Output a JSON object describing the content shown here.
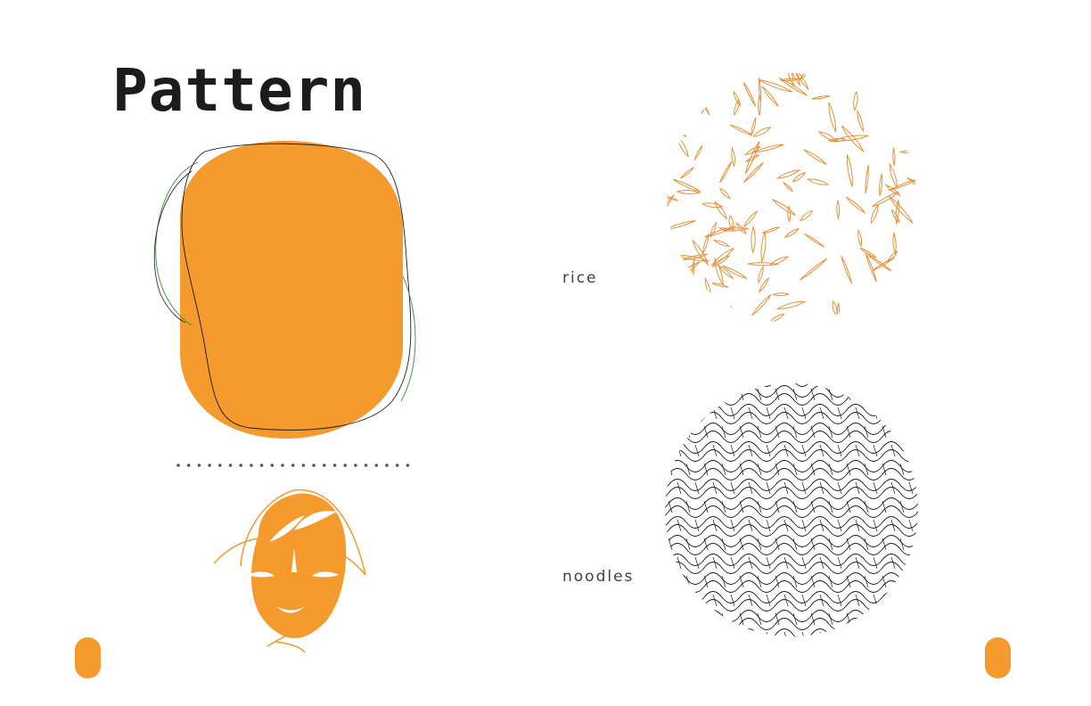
{
  "page": {
    "title": "Pattern",
    "accent_color": "#f59a2c",
    "ink_color": "#1c1c1c"
  },
  "patterns": [
    {
      "label": "rice",
      "motif": "rice-grain-scatter",
      "color": "#e8913a"
    },
    {
      "label": "noodles",
      "motif": "wavy-noodle-lines",
      "color": "#1a1a1a"
    }
  ],
  "illustrations": {
    "shape": "orange-rounded-blob-with-outlines",
    "separator": "dotted-line",
    "mascot": "orange-face-with-hair-icon"
  },
  "page_tabs": [
    "left",
    "right"
  ]
}
